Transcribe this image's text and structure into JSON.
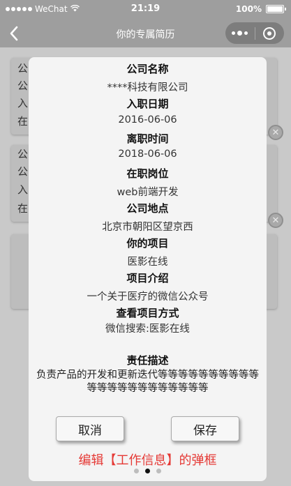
{
  "status_bar": {
    "carrier": "WeChat",
    "time": "21:19",
    "battery": "100%"
  },
  "nav": {
    "title": "你的专属简历"
  },
  "background_cards": [
    {
      "lines": [
        "公",
        "公",
        "入",
        "在"
      ]
    },
    {
      "lines": [
        "公",
        "公",
        "入",
        "在"
      ]
    }
  ],
  "modal": {
    "fields": [
      {
        "label": "公司名称",
        "value": "****科技有限公司"
      },
      {
        "label": "入职日期",
        "value": "2016-06-06"
      },
      {
        "label": "离职时间",
        "value": "2018-06-06"
      },
      {
        "label": "在职岗位",
        "value": "web前端开发"
      },
      {
        "label": "公司地点",
        "value": "北京市朝阳区望京西"
      },
      {
        "label": "你的项目",
        "value": "医影在线"
      },
      {
        "label": "项目介绍",
        "value": "一个关于医疗的微信公众号"
      },
      {
        "label": "查看项目方式",
        "value": "微信搜索:医影在线"
      }
    ],
    "responsibility": {
      "label": "责任描述",
      "text": "负责产品的开发和更新迭代等等等等等等等等等等等等等等等等等等等等等等"
    },
    "cancel_label": "取消",
    "save_label": "保存",
    "caption": "编辑【工作信息】的弹框"
  },
  "pagination": {
    "count": 3,
    "active": 2
  },
  "colors": {
    "caption": "#e53935",
    "nav_bg": "#9e9e9e",
    "overlay_bg": "#c9c9c9"
  }
}
